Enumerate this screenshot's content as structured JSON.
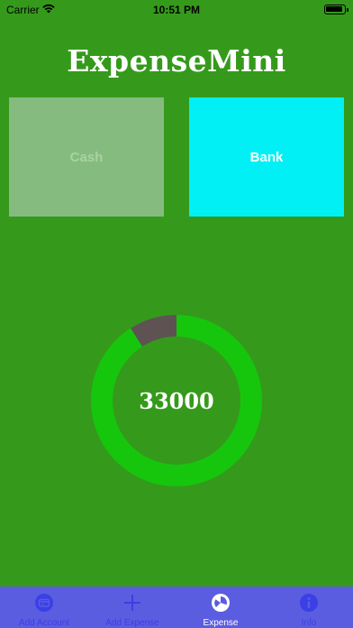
{
  "status_bar": {
    "carrier": "Carrier",
    "time": "10:51 PM"
  },
  "app": {
    "title": "ExpenseMini"
  },
  "accounts": [
    {
      "label": "Cash",
      "color": "#86bb80"
    },
    {
      "label": "Bank",
      "color": "#00f0f5"
    }
  ],
  "summary": {
    "total": "33000",
    "ring_color": "#16c60d",
    "spent_color": "#5e5252",
    "spent_fraction": 0.09
  },
  "tab_bar": {
    "background": "#5b5de0",
    "items": [
      {
        "label": "Add Account",
        "icon": "card-icon"
      },
      {
        "label": "Add Expense",
        "icon": "plus-icon"
      },
      {
        "label": "Expense",
        "icon": "pie-chart-icon",
        "active": true
      },
      {
        "label": "Info",
        "icon": "info-icon"
      }
    ]
  }
}
